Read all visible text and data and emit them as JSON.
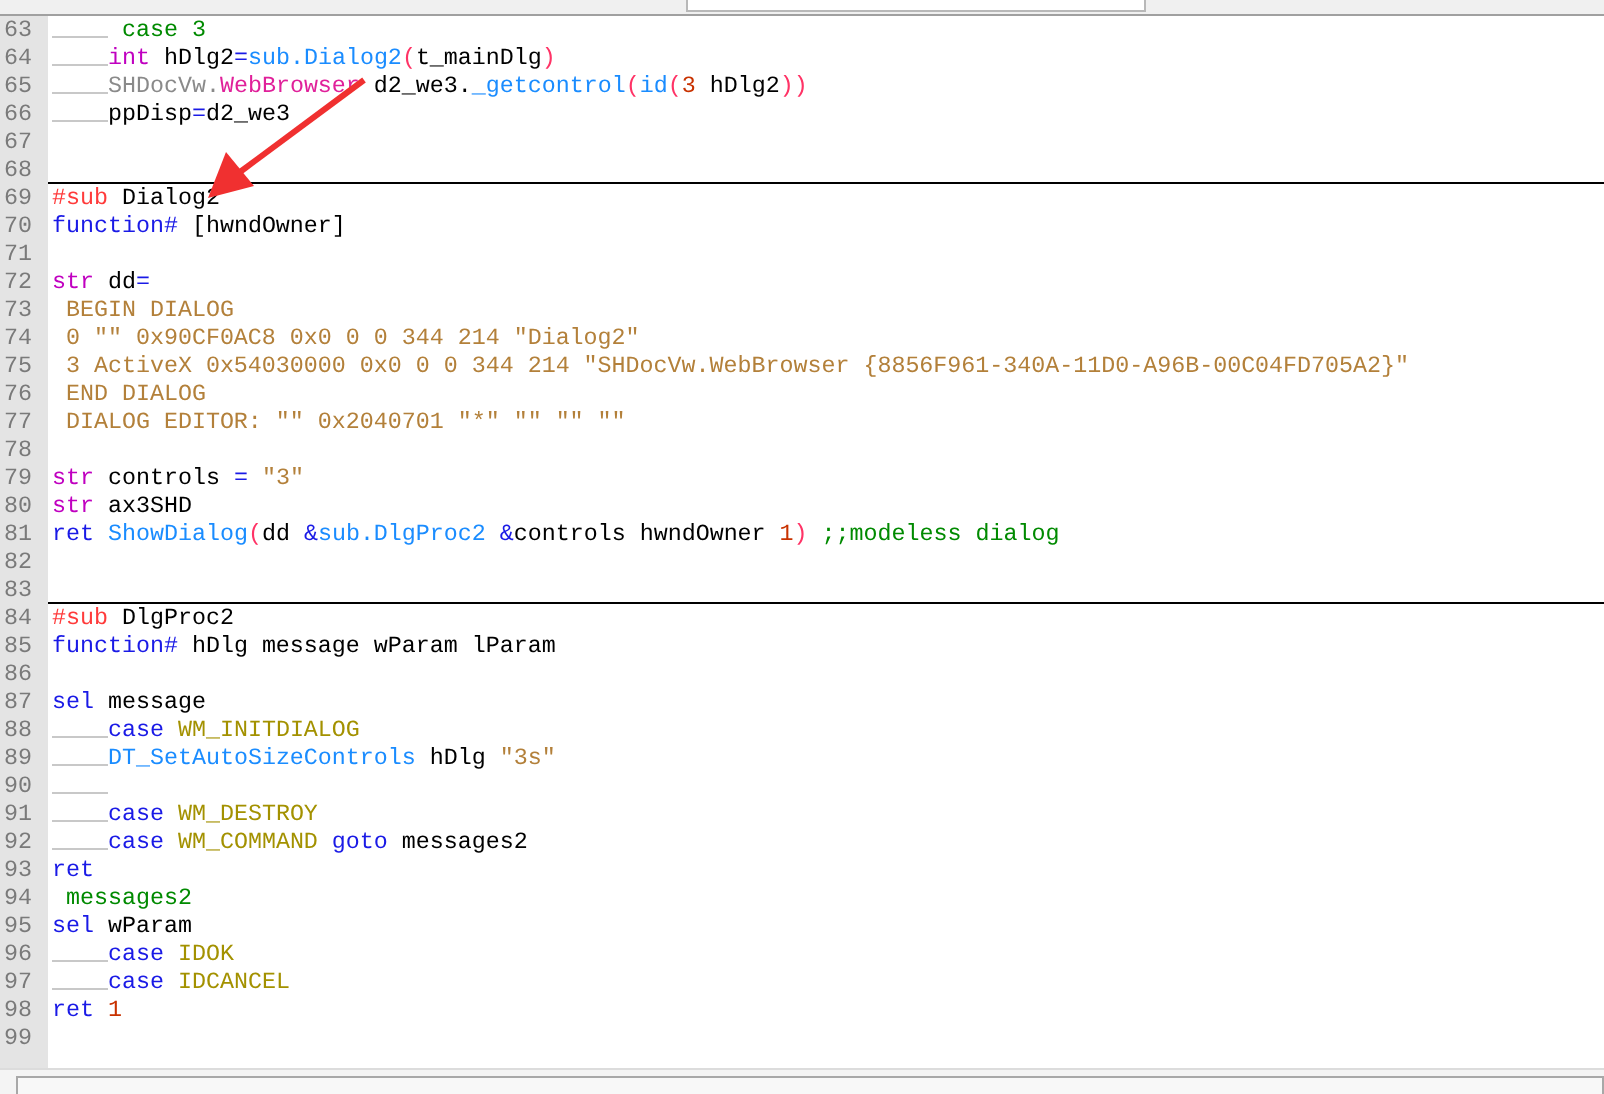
{
  "lines": [
    {
      "number": "63",
      "indented": true,
      "tokens": [
        {
          "text": " case 3",
          "kind": "comment"
        }
      ]
    },
    {
      "number": "64",
      "indented": true,
      "tokens": [
        {
          "text": "int",
          "kind": "type"
        },
        {
          "text": " hDlg2",
          "kind": "plain"
        },
        {
          "text": "=",
          "kind": "op"
        },
        {
          "text": "sub.Dialog2",
          "kind": "func"
        },
        {
          "text": "(",
          "kind": "paren"
        },
        {
          "text": "t_mainDlg",
          "kind": "plain"
        },
        {
          "text": ")",
          "kind": "paren"
        }
      ]
    },
    {
      "number": "65",
      "indented": true,
      "tokens": [
        {
          "text": "SHDocVw.",
          "kind": "grey"
        },
        {
          "text": "WebBrowser",
          "kind": "member"
        },
        {
          "text": " d2_we3.",
          "kind": "plain"
        },
        {
          "text": "_getcontrol",
          "kind": "func"
        },
        {
          "text": "(",
          "kind": "paren"
        },
        {
          "text": "id",
          "kind": "func"
        },
        {
          "text": "(",
          "kind": "paren"
        },
        {
          "text": "3",
          "kind": "number"
        },
        {
          "text": " hDlg2",
          "kind": "plain"
        },
        {
          "text": "))",
          "kind": "paren"
        }
      ]
    },
    {
      "number": "66",
      "indented": true,
      "tokens": [
        {
          "text": "ppDisp",
          "kind": "plain"
        },
        {
          "text": "=",
          "kind": "op"
        },
        {
          "text": "d2_we3",
          "kind": "plain"
        }
      ]
    },
    {
      "number": "67",
      "indented": false
    },
    {
      "number": "68",
      "indented": false
    },
    {
      "number": "69",
      "indented": false,
      "tokens": [
        {
          "text": "#sub",
          "kind": "directive"
        },
        {
          "text": " Dialog2",
          "kind": "plain"
        }
      ]
    },
    {
      "number": "70",
      "indented": false,
      "tokens": [
        {
          "text": "function#",
          "kind": "keyword"
        },
        {
          "text": " [hwndOwner]",
          "kind": "plain"
        }
      ]
    },
    {
      "number": "71",
      "indented": false
    },
    {
      "number": "72",
      "indented": false,
      "tokens": [
        {
          "text": "str",
          "kind": "type"
        },
        {
          "text": " dd",
          "kind": "plain"
        },
        {
          "text": "=",
          "kind": "op"
        }
      ]
    },
    {
      "number": "73",
      "indented": false,
      "tokens": [
        {
          "text": " BEGIN DIALOG",
          "kind": "string"
        }
      ]
    },
    {
      "number": "74",
      "indented": false,
      "tokens": [
        {
          "text": " 0 \"\" 0x90CF0AC8 0x0 0 0 344 214 \"Dialog2\"",
          "kind": "string"
        }
      ]
    },
    {
      "number": "75",
      "indented": false,
      "tokens": [
        {
          "text": " 3 ActiveX 0x54030000 0x0 0 0 344 214 \"SHDocVw.WebBrowser {8856F961-340A-11D0-A96B-00C04FD705A2}\"",
          "kind": "string"
        }
      ]
    },
    {
      "number": "76",
      "indented": false,
      "tokens": [
        {
          "text": " END DIALOG",
          "kind": "string"
        }
      ]
    },
    {
      "number": "77",
      "indented": false,
      "tokens": [
        {
          "text": " DIALOG EDITOR: \"\" 0x2040701 \"*\" \"\" \"\" \"\"",
          "kind": "string"
        }
      ]
    },
    {
      "number": "78",
      "indented": false
    },
    {
      "number": "79",
      "indented": false,
      "tokens": [
        {
          "text": "str",
          "kind": "type"
        },
        {
          "text": " controls ",
          "kind": "plain"
        },
        {
          "text": "=",
          "kind": "op"
        },
        {
          "text": " \"3\"",
          "kind": "string"
        }
      ]
    },
    {
      "number": "80",
      "indented": false,
      "tokens": [
        {
          "text": "str",
          "kind": "type"
        },
        {
          "text": " ax3SHD",
          "kind": "plain"
        }
      ]
    },
    {
      "number": "81",
      "indented": false,
      "tokens": [
        {
          "text": "ret",
          "kind": "keyword"
        },
        {
          "text": " ShowDialog",
          "kind": "func"
        },
        {
          "text": "(",
          "kind": "paren"
        },
        {
          "text": "dd ",
          "kind": "plain"
        },
        {
          "text": "&",
          "kind": "op"
        },
        {
          "text": "sub.DlgProc2 ",
          "kind": "func"
        },
        {
          "text": "&",
          "kind": "op"
        },
        {
          "text": "controls hwndOwner ",
          "kind": "plain"
        },
        {
          "text": "1",
          "kind": "number"
        },
        {
          "text": ")",
          "kind": "paren"
        },
        {
          "text": " ;;modeless dialog",
          "kind": "comment"
        }
      ]
    },
    {
      "number": "82",
      "indented": false
    },
    {
      "number": "83",
      "indented": false
    },
    {
      "number": "84",
      "indented": false,
      "tokens": [
        {
          "text": "#sub",
          "kind": "directive"
        },
        {
          "text": " DlgProc2",
          "kind": "plain"
        }
      ]
    },
    {
      "number": "85",
      "indented": false,
      "tokens": [
        {
          "text": "function#",
          "kind": "keyword"
        },
        {
          "text": " hDlg message wParam lParam",
          "kind": "plain"
        }
      ]
    },
    {
      "number": "86",
      "indented": false
    },
    {
      "number": "87",
      "indented": false,
      "tokens": [
        {
          "text": "sel",
          "kind": "keyword"
        },
        {
          "text": " message",
          "kind": "plain"
        }
      ]
    },
    {
      "number": "88",
      "indented": true,
      "tokens": [
        {
          "text": "case",
          "kind": "keyword"
        },
        {
          "text": " WM_INITDIALOG",
          "kind": "const"
        }
      ]
    },
    {
      "number": "89",
      "indented": true,
      "tokens": [
        {
          "text": "DT_SetAutoSizeControls",
          "kind": "func"
        },
        {
          "text": " hDlg ",
          "kind": "plain"
        },
        {
          "text": "\"3s\"",
          "kind": "string"
        }
      ]
    },
    {
      "number": "90",
      "indented": true
    },
    {
      "number": "91",
      "indented": true,
      "tokens": [
        {
          "text": "case",
          "kind": "keyword"
        },
        {
          "text": " WM_DESTROY",
          "kind": "const"
        }
      ]
    },
    {
      "number": "92",
      "indented": true,
      "tokens": [
        {
          "text": "case",
          "kind": "keyword"
        },
        {
          "text": " WM_COMMAND",
          "kind": "const"
        },
        {
          "text": " goto",
          "kind": "keyword"
        },
        {
          "text": " messages2",
          "kind": "plain"
        }
      ]
    },
    {
      "number": "93",
      "indented": false,
      "tokens": [
        {
          "text": "ret",
          "kind": "keyword"
        }
      ]
    },
    {
      "number": "94",
      "indented": false,
      "tokens": [
        {
          "text": " messages2",
          "kind": "comment"
        }
      ]
    },
    {
      "number": "95",
      "indented": false,
      "tokens": [
        {
          "text": "sel",
          "kind": "keyword"
        },
        {
          "text": " wParam",
          "kind": "plain"
        }
      ]
    },
    {
      "number": "96",
      "indented": true,
      "tokens": [
        {
          "text": "case",
          "kind": "keyword"
        },
        {
          "text": " IDOK",
          "kind": "const"
        }
      ]
    },
    {
      "number": "97",
      "indented": true,
      "tokens": [
        {
          "text": "case",
          "kind": "keyword"
        },
        {
          "text": " IDCANCEL",
          "kind": "const"
        }
      ]
    },
    {
      "number": "98",
      "indented": false,
      "tokens": [
        {
          "text": "ret",
          "kind": "keyword"
        },
        {
          "text": " 1",
          "kind": "number"
        }
      ]
    },
    {
      "number": "99",
      "indented": false
    }
  ]
}
